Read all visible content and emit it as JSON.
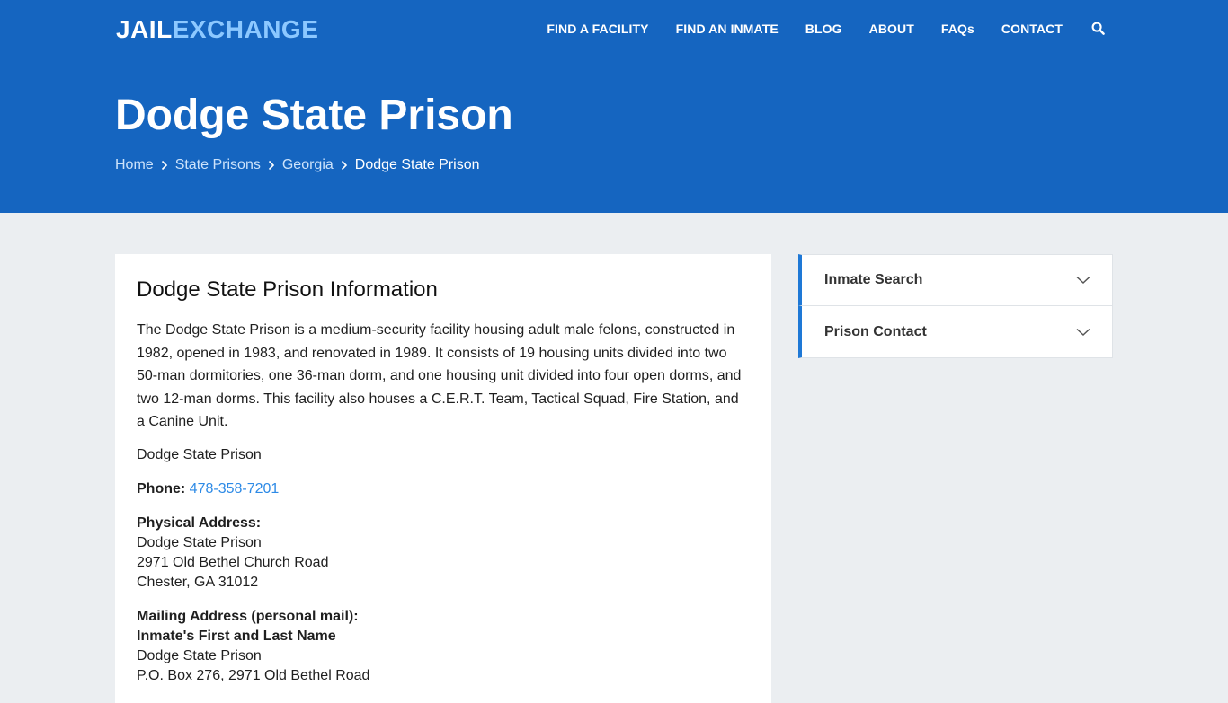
{
  "header": {
    "logo_part1": "JAIL",
    "logo_part2": "EXCHANGE",
    "nav": [
      "FIND A FACILITY",
      "FIND AN INMATE",
      "BLOG",
      "ABOUT",
      "FAQs",
      "CONTACT"
    ],
    "search_icon": "search-icon"
  },
  "hero": {
    "title": "Dodge State Prison",
    "breadcrumb": [
      "Home",
      "State Prisons",
      "Georgia",
      "Dodge State Prison"
    ]
  },
  "main": {
    "heading": "Dodge State Prison Information",
    "intro": "The Dodge State Prison is a medium-security facility housing adult male felons, constructed in 1982, opened in 1983, and renovated in 1989. It consists of 19 housing units divided into two 50-man dormitories, one 36-man dorm, and one housing unit divided into four open dorms, and two 12-man dorms. This facility also houses a C.E.R.T. Team, Tactical Squad, Fire Station, and a Canine Unit.",
    "facility_name": "Dodge State Prison",
    "phone_label": "Phone:",
    "phone": "478-358-7201",
    "physical_label": "Physical Address:",
    "physical": [
      "Dodge State Prison",
      "2971 Old Bethel Church Road",
      "Chester, GA 31012"
    ],
    "mailing_label": "Mailing Address (personal mail):",
    "mailing_name_label": "Inmate's First and Last Name",
    "mailing": [
      "Dodge State Prison",
      "P.O. Box 276, 2971 Old Bethel Road"
    ]
  },
  "sidebar": {
    "items": [
      "Inmate Search",
      "Prison Contact"
    ]
  },
  "colors": {
    "brand_blue": "#1565c0",
    "logo_accent": "#8cc8ff",
    "link": "#2d8ae6",
    "accordion_accent": "#1e78d6",
    "page_bg": "#ebeef1"
  }
}
